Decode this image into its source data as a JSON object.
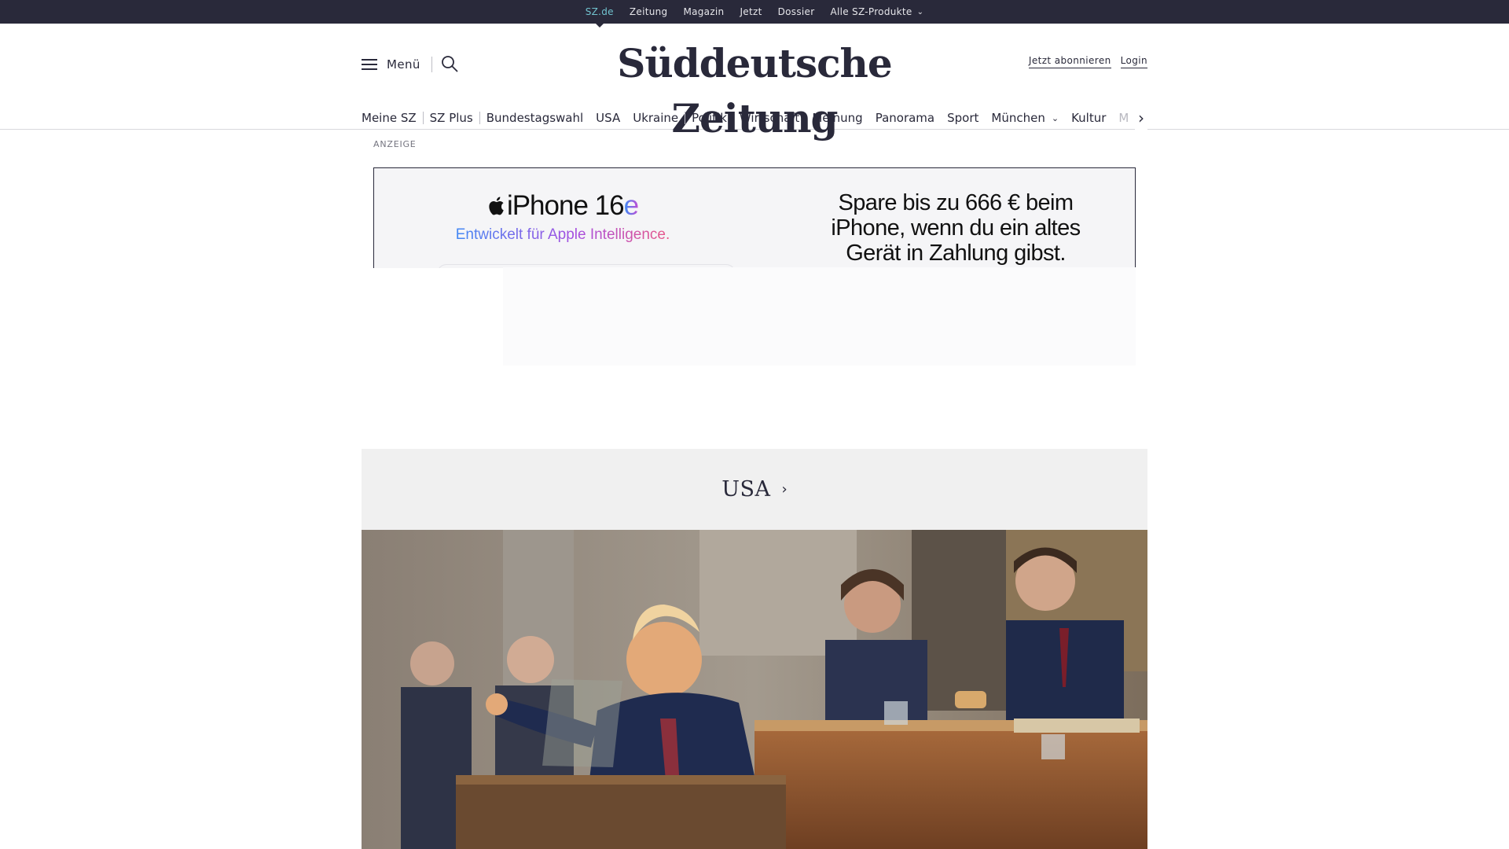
{
  "topbar": {
    "links": [
      "SZ.de",
      "Zeitung",
      "Magazin",
      "Jetzt",
      "Dossier",
      "Alle SZ-Produkte"
    ]
  },
  "header": {
    "menu_label": "Menü",
    "logo": "Süddeutsche Zeitung",
    "subscribe": "Jetzt abonnieren",
    "login": "Login"
  },
  "nav": {
    "items": [
      "Meine SZ",
      "SZ Plus",
      "Bundestagswahl",
      "USA",
      "Ukraine",
      "Politik",
      "Wirtschaft",
      "Meinung",
      "Panorama",
      "Sport",
      "München",
      "Kultur",
      "M"
    ]
  },
  "ad": {
    "label": "ANZEIGE",
    "product": "iPhone 16",
    "product_suffix": "e",
    "tagline": "Entwickelt für Apple Intelligence.",
    "offer_line1": "Spare bis zu 666 € beim",
    "offer_line2": "iPhone, wenn du ein altes",
    "offer_line3": "Gerät in Zahlung gibst."
  },
  "section": {
    "title": "USA",
    "arrow": "›"
  },
  "colors": {
    "topbar_bg": "#29293a",
    "active_link": "#71c3cf",
    "text": "#29293a",
    "section_bg": "#f0f0f0"
  }
}
